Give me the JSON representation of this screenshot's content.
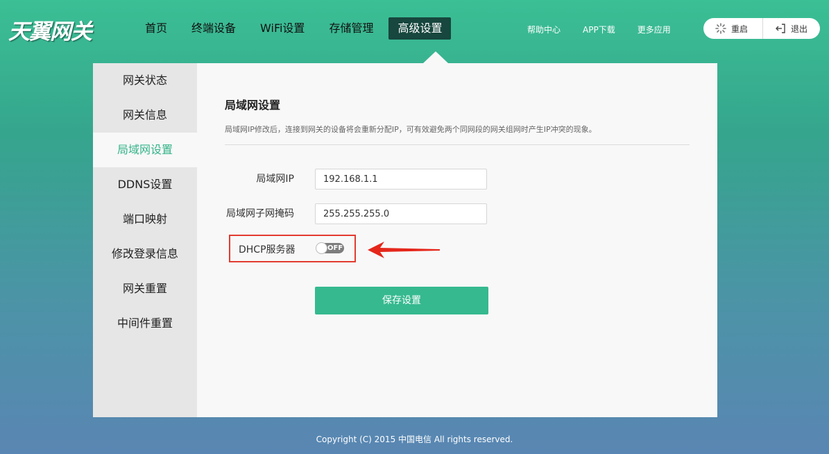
{
  "brand": {
    "logo": "天翼网关"
  },
  "nav": {
    "items": [
      {
        "label": "首页"
      },
      {
        "label": "终端设备"
      },
      {
        "label": "WiFi设置"
      },
      {
        "label": "存储管理"
      },
      {
        "label": "高级设置"
      }
    ],
    "active": "高级设置"
  },
  "top_links": {
    "help": "帮助中心",
    "app": "APP下载",
    "more": "更多应用"
  },
  "top_actions": {
    "restart": "重启",
    "logout": "退出"
  },
  "sidebar": {
    "items": [
      {
        "label": "网关状态"
      },
      {
        "label": "网关信息"
      },
      {
        "label": "局域网设置"
      },
      {
        "label": "DDNS设置"
      },
      {
        "label": "端口映射"
      },
      {
        "label": "修改登录信息"
      },
      {
        "label": "网关重置"
      },
      {
        "label": "中间件重置"
      }
    ],
    "active": "局域网设置"
  },
  "lan": {
    "title": "局域网设置",
    "description": "局域网IP修改后，连接到网关的设备将会重新分配IP，可有效避免两个同网段的网关组网时产生IP冲突的现象。",
    "ip_label": "局域网IP",
    "ip_value": "192.168.1.1",
    "mask_label": "局域网子网掩码",
    "mask_value": "255.255.255.0",
    "dhcp_label": "DHCP服务器",
    "dhcp_state": "OFF",
    "save_label": "保存设置"
  },
  "colors": {
    "accent": "#36b98f",
    "nav_active": "#17473e",
    "highlight_box": "#e23b30"
  },
  "footer": {
    "copyright": "Copyright (C) 2015 中国电信 All rights reserved."
  }
}
